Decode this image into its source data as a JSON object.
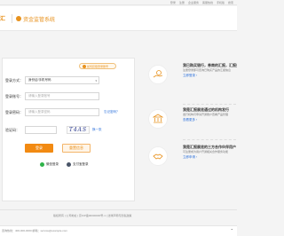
{
  "topnav": [
    "登录",
    "注册",
    "企业服务",
    "客服热线",
    "手机版",
    "搜索"
  ],
  "header": {
    "logo": "汇",
    "title": "资金监管系统"
  },
  "tip": "如何获取登录账号",
  "form": {
    "login_type": {
      "label": "登录方式：",
      "value": "身份证/手机号码"
    },
    "account": {
      "label": "登录账号：",
      "placeholder": "请输入登录账号"
    },
    "password": {
      "label": "登录密码：",
      "placeholder": "请输入登录密码",
      "forgot": "忘记密码？"
    },
    "captcha": {
      "label": "验证码：",
      "placeholder": "",
      "code": "T4AS",
      "refresh": "换一张"
    },
    "login_label": "登录",
    "reset_label": "重置信息",
    "qr": {
      "wechat": "微信登录",
      "alipay": "支付宝登录"
    }
  },
  "side": [
    {
      "title": "我已购买银行，券商的汇报，汇报查看",
      "desc": "注册登录即可查询已购买产品的汇报信息",
      "link": "立即登录 ›"
    },
    {
      "title": "我是汇报展览通过的机构发行",
      "desc": "发行机构可申请开通账户查看产品管理",
      "link": "查看更多 ›"
    },
    {
      "title": "我是汇报展览的三方合作伙伴用户",
      "desc": "可注册成为用户开通相关合作服务功能",
      "link": "立即申请 ›"
    }
  ],
  "footer": {
    "text": "版权所有 | 公司地址 | 京ICP备00000000号-1 | 法律声明与隐私政策"
  },
  "bottom": {
    "text": "咨询热线：400-000-0000 邮箱：service@example.com",
    "mark": "⌃"
  },
  "colors": {
    "accent": "#f28a12",
    "link": "#2a6fdb"
  }
}
